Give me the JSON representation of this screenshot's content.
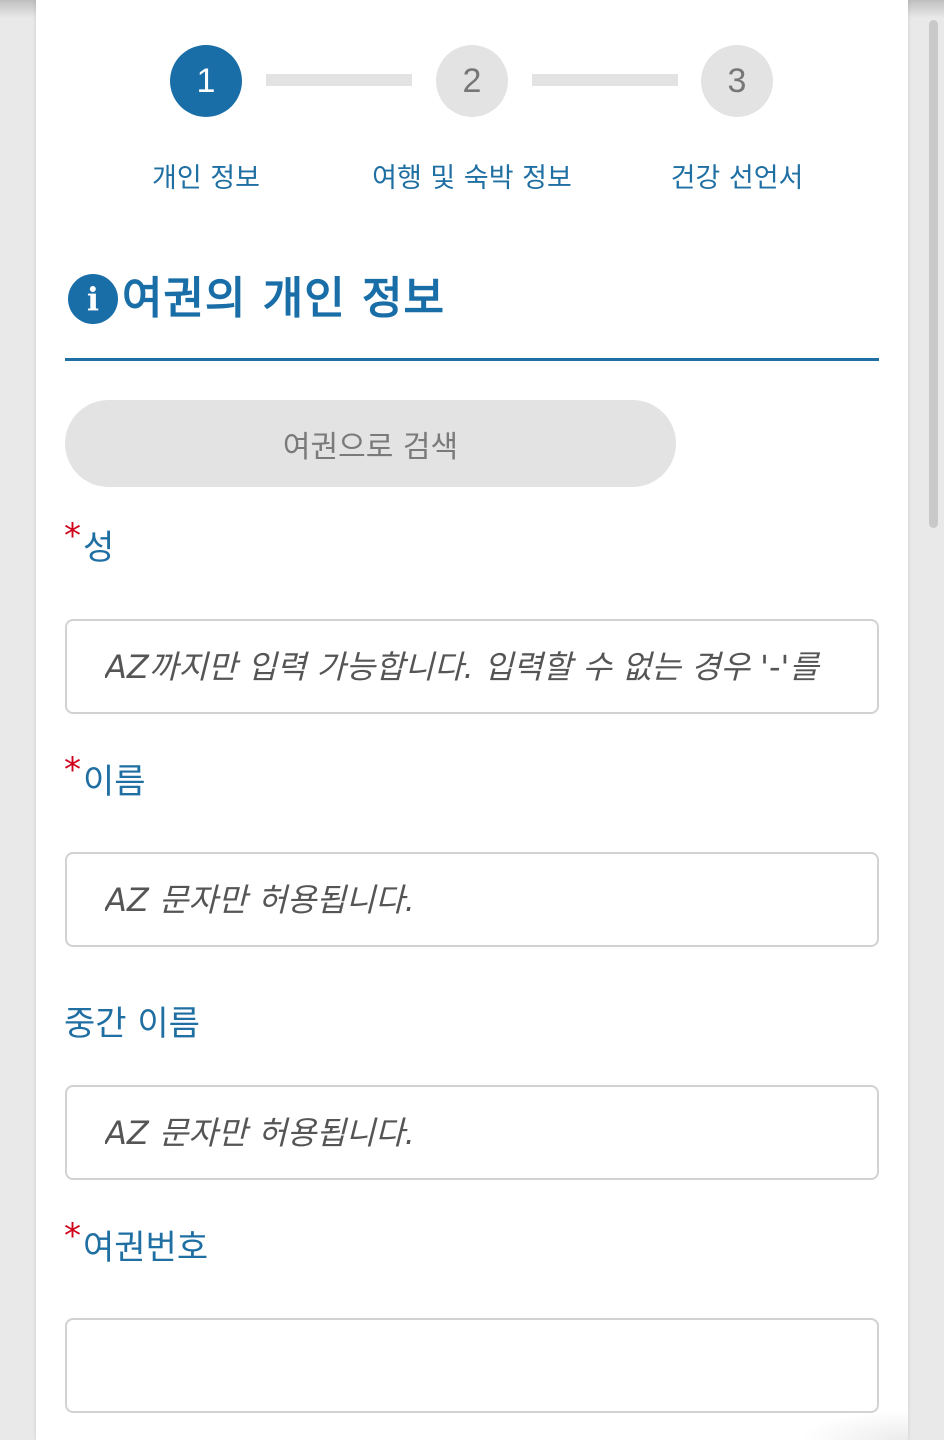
{
  "stepper": {
    "steps": [
      {
        "number": "1",
        "label": "개인 정보",
        "state": "active"
      },
      {
        "number": "2",
        "label": "여행 및 숙박 정보",
        "state": "inactive"
      },
      {
        "number": "3",
        "label": "건강 선언서",
        "state": "inactive"
      }
    ]
  },
  "section": {
    "info_icon": "i",
    "title": "여권의 개인 정보"
  },
  "search_button": {
    "label": "여권으로 검색"
  },
  "fields": {
    "surname": {
      "required_mark": "*",
      "label": "성",
      "placeholder": "AZ까지만 입력 가능합니다. 입력할 수 없는 경우 '-'를"
    },
    "given_name": {
      "required_mark": "*",
      "label": "이름",
      "placeholder": "AZ 문자만 허용됩니다."
    },
    "middle_name": {
      "label": "중간 이름",
      "placeholder": "AZ 문자만 허용됩니다."
    },
    "passport_number": {
      "required_mark": "*",
      "label": "여권번호",
      "placeholder": ""
    }
  },
  "colors": {
    "primary": "#1a6ea8",
    "label_text": "#1f6fa3",
    "required": "#d0021b",
    "inactive_step": "#e3e3e3"
  }
}
